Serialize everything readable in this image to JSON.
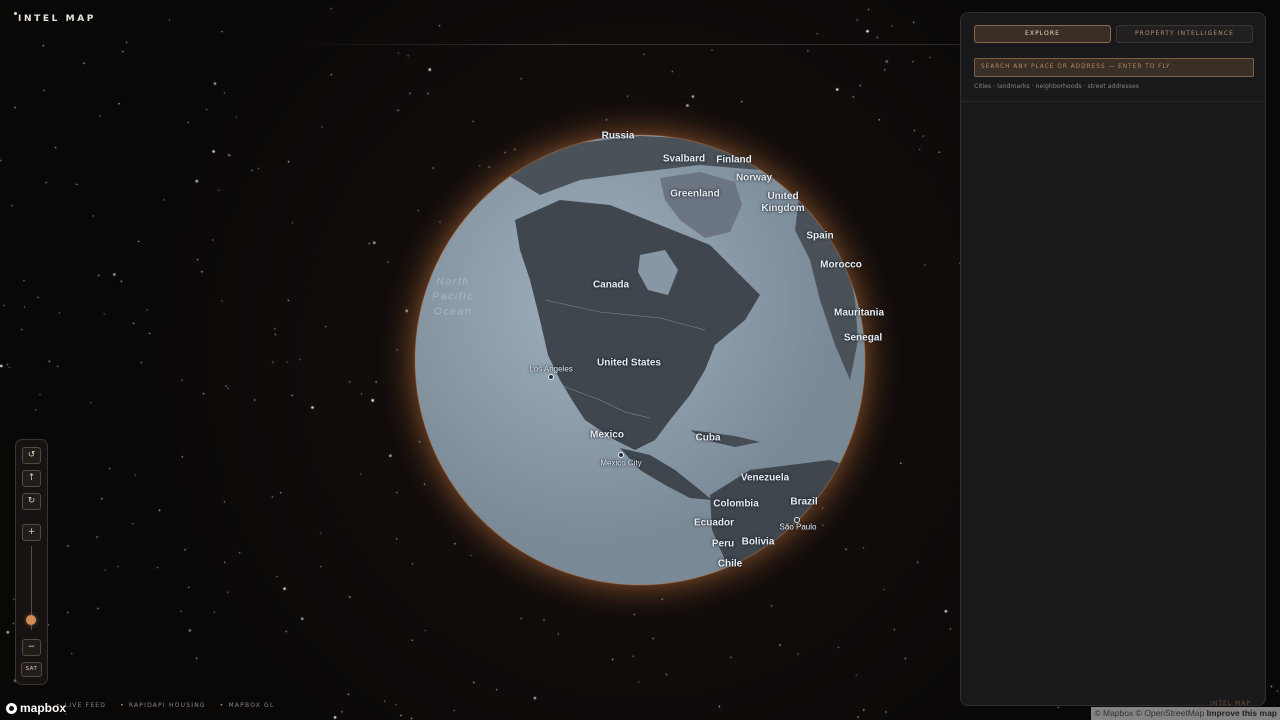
{
  "app": {
    "title": "INTEL MAP"
  },
  "map": {
    "view": "globe",
    "style": "satellite",
    "ocean_label": "North Pacific Ocean",
    "labels": {
      "russia": "Russia",
      "svalbard": "Svalbard",
      "finland": "Finland",
      "norway": "Norway",
      "greenland": "Greenland",
      "uk": "United Kingdom",
      "spain": "Spain",
      "morocco": "Morocco",
      "mauritania": "Mauritania",
      "senegal": "Senegal",
      "canada": "Canada",
      "us": "United States",
      "mexico": "Mexico",
      "cuba": "Cuba",
      "venezuela": "Venezuela",
      "colombia": "Colombia",
      "brazil": "Brazil",
      "ecuador": "Ecuador",
      "peru": "Peru",
      "bolivia": "Bolivia",
      "chile": "Chile"
    },
    "cities": {
      "los_angeles": "Los Angeles",
      "mexico_city": "Mexico City",
      "sao_paulo": "São Paulo"
    }
  },
  "controls": {
    "rotate_left_icon": "↺",
    "north_icon": "↑",
    "rotate_right_icon": "↻",
    "zoom_in": "+",
    "zoom_out": "−",
    "zoom_level_fraction": 0.12,
    "layer_toggle": "SAT"
  },
  "footer": {
    "feeds": [
      "LIVE FEED",
      "RAPIDAPI HOUSING",
      "MAPBOX GL"
    ],
    "logo_text": "mapbox",
    "attribution_left": "© Mapbox © OpenStreetMap",
    "attribution_link": "Improve this map"
  },
  "panel": {
    "tabs": [
      {
        "label": "EXPLORE",
        "active": true
      },
      {
        "label": "PROPERTY INTELLIGENCE",
        "active": false
      }
    ],
    "search_placeholder": "SEARCH ANY PLACE OR ADDRESS — ENTER TO FLY",
    "hint": "Cities · landmarks · neighborhoods · street addresses",
    "footer_brand": "INTEL MAP"
  },
  "colors": {
    "accent": "#d38c55",
    "ocean": "#8a99a7",
    "land": "#454c54",
    "panel_bg": "#19181b"
  }
}
